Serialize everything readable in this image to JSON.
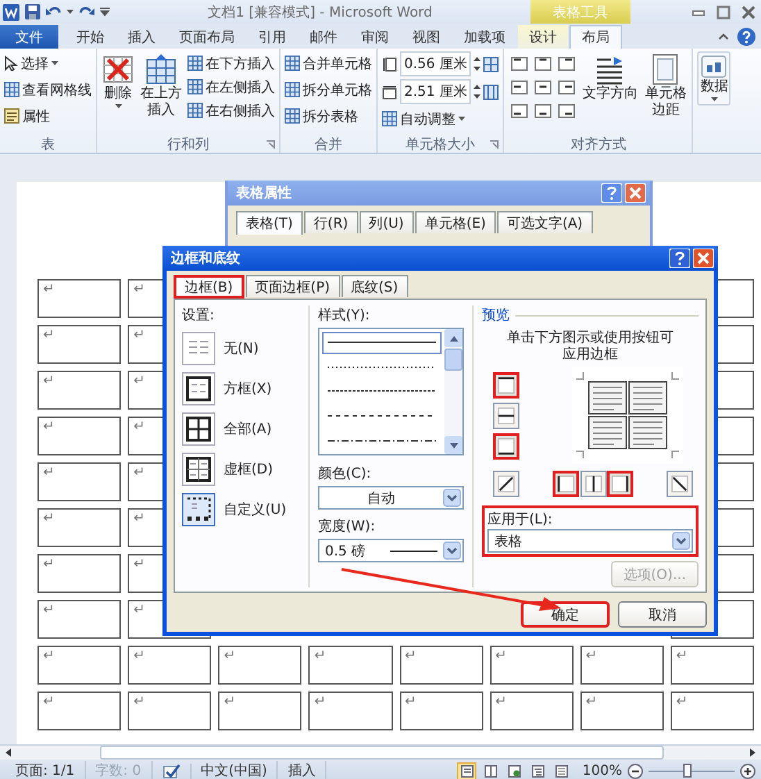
{
  "title_bar": {
    "title": "文档1 [兼容模式] - Microsoft Word",
    "context_label": "表格工具"
  },
  "ribbon_tabs": [
    {
      "label": "文件",
      "kind": "file",
      "selected": false
    },
    {
      "label": "开始",
      "kind": "plain",
      "selected": false
    },
    {
      "label": "插入",
      "kind": "plain",
      "selected": false
    },
    {
      "label": "页面布局",
      "kind": "plain",
      "selected": false
    },
    {
      "label": "引用",
      "kind": "plain",
      "selected": false
    },
    {
      "label": "邮件",
      "kind": "plain",
      "selected": false
    },
    {
      "label": "审阅",
      "kind": "plain",
      "selected": false
    },
    {
      "label": "视图",
      "kind": "plain",
      "selected": false
    },
    {
      "label": "加载项",
      "kind": "plain",
      "selected": false
    },
    {
      "label": "设计",
      "kind": "context",
      "selected": false
    },
    {
      "label": "布局",
      "kind": "context",
      "selected": true
    }
  ],
  "ribbon": {
    "table": {
      "label": "表",
      "select": "选择",
      "gridlines": "查看网格线",
      "properties": "属性"
    },
    "rows_cols": {
      "label": "行和列",
      "delete": "删除",
      "insert_above": "在上方插入",
      "insert_below": "在下方插入",
      "insert_left": "在左侧插入",
      "insert_right": "在右侧插入"
    },
    "merge": {
      "label": "合并",
      "merge_cells": "合并单元格",
      "split_cells": "拆分单元格",
      "split_table": "拆分表格"
    },
    "cell_size": {
      "label": "单元格大小",
      "height": "0.56 厘米",
      "width": "2.51 厘米",
      "autofit": "自动调整"
    },
    "alignment": {
      "label": "对齐方式",
      "text_direction": "文字方向",
      "cell_margins": "单元格边距"
    },
    "data": {
      "button": "数据"
    }
  },
  "document": {
    "table_rows": [
      {
        "marks": [
          "↵",
          "↵"
        ]
      },
      {
        "marks": [
          "↵",
          "↵"
        ]
      },
      {
        "marks": [
          "↵",
          "↵"
        ]
      },
      {
        "marks": [
          "↵",
          "↵"
        ]
      },
      {
        "marks": [
          "↵",
          "↵"
        ]
      },
      {
        "marks": [
          "↵",
          "↵"
        ]
      },
      {
        "marks": [
          "↵",
          "↵"
        ]
      },
      {
        "marks": [
          "↵",
          "↵"
        ]
      },
      {
        "marks": [
          "↵",
          "↵",
          "↵",
          "↵",
          "↵",
          "↵",
          "↵",
          "↵"
        ]
      },
      {
        "marks": [
          "↵",
          "↵",
          "↵",
          "↵",
          "↵",
          "↵",
          "↵",
          "↵"
        ]
      }
    ]
  },
  "table_properties_dialog": {
    "title": "表格属性",
    "tabs": [
      {
        "label": "表格(T)",
        "selected": true
      },
      {
        "label": "行(R)",
        "selected": false
      },
      {
        "label": "列(U)",
        "selected": false
      },
      {
        "label": "单元格(E)",
        "selected": false
      },
      {
        "label": "可选文字(A)",
        "selected": false
      }
    ]
  },
  "borders_dialog": {
    "title": "边框和底纹",
    "tabs": [
      {
        "label": "边框(B)",
        "selected": true,
        "highlighted": true
      },
      {
        "label": "页面边框(P)",
        "selected": false,
        "highlighted": false
      },
      {
        "label": "底纹(S)",
        "selected": false,
        "highlighted": false
      }
    ],
    "setting_label": "设置:",
    "settings": [
      {
        "label": "无(N)",
        "kind": "none",
        "selected": false
      },
      {
        "label": "方框(X)",
        "kind": "box",
        "selected": false
      },
      {
        "label": "全部(A)",
        "kind": "all",
        "selected": false
      },
      {
        "label": "虚框(D)",
        "kind": "grid",
        "selected": false
      },
      {
        "label": "自定义(U)",
        "kind": "custom",
        "selected": true
      }
    ],
    "style_label": "样式(Y):",
    "line_styles": [
      {
        "kind": "solid",
        "selected": true
      },
      {
        "kind": "dotted",
        "selected": false
      },
      {
        "kind": "fine_dash",
        "selected": false
      },
      {
        "kind": "dashed",
        "selected": false
      },
      {
        "kind": "dash_dot",
        "selected": false
      }
    ],
    "color_label": "颜色(C):",
    "color_value": "自动",
    "width_label": "宽度(W):",
    "width_value": "0.5 磅",
    "preview_label": "预览",
    "preview_hint": "单击下方图示或使用按钮可应用边框",
    "border_buttons": [
      {
        "kind": "top",
        "highlighted": true
      },
      {
        "kind": "inside_h",
        "highlighted": false
      },
      {
        "kind": "bottom",
        "highlighted": true
      },
      {
        "kind": "diag_up",
        "highlighted": false
      },
      {
        "kind": "left",
        "highlighted": true
      },
      {
        "kind": "inside_v",
        "highlighted": false
      },
      {
        "kind": "right",
        "highlighted": true
      },
      {
        "kind": "diag_down",
        "highlighted": false
      }
    ],
    "apply_label": "应用于(L):",
    "apply_value": "表格",
    "apply_highlighted": true,
    "options_button": {
      "label": "选项(O)...",
      "disabled": true
    },
    "ok_button": {
      "label": "确定",
      "highlighted": true
    },
    "cancel_button": {
      "label": "取消",
      "highlighted": false
    }
  },
  "status_bar": {
    "page": "页面: 1/1",
    "words": "字数: 0",
    "words_disabled": true,
    "language": "中文(中国)",
    "mode": "插入",
    "views": [
      {
        "kind": "print",
        "selected": true
      },
      {
        "kind": "reading",
        "selected": false
      },
      {
        "kind": "web",
        "selected": false
      },
      {
        "kind": "outline",
        "selected": false
      },
      {
        "kind": "draft",
        "selected": false
      }
    ],
    "zoom": "100%",
    "zoom_slider": {
      "level": 0.45
    }
  }
}
